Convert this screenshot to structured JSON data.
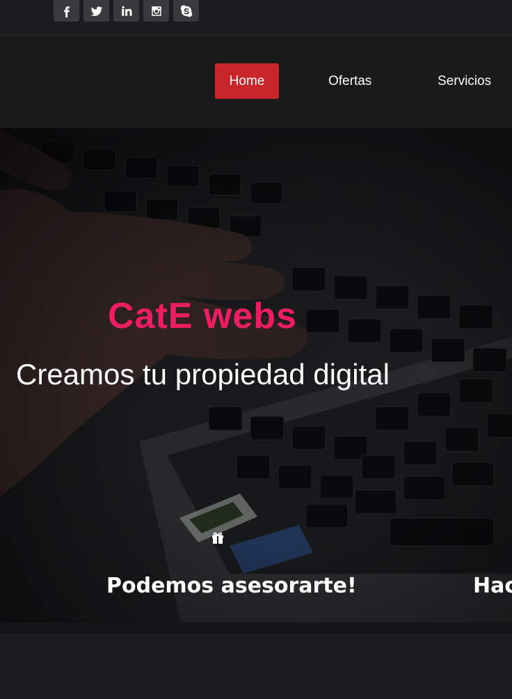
{
  "social": {
    "icons": [
      "facebook-icon",
      "twitter-icon",
      "linkedin-icon",
      "instagram-icon",
      "skype-icon"
    ]
  },
  "nav": {
    "home": "Home",
    "ofertas": "Ofertas",
    "servicios": "Servicios"
  },
  "hero": {
    "title": "CatE webs",
    "subtitle": "Creamos tu propiedad digital"
  },
  "features": {
    "icon": "gift-icon",
    "item1": "Podemos asesorarte!",
    "item2": "Hac"
  },
  "colors": {
    "accent": "#c8262b",
    "title": "#ee1d62"
  }
}
